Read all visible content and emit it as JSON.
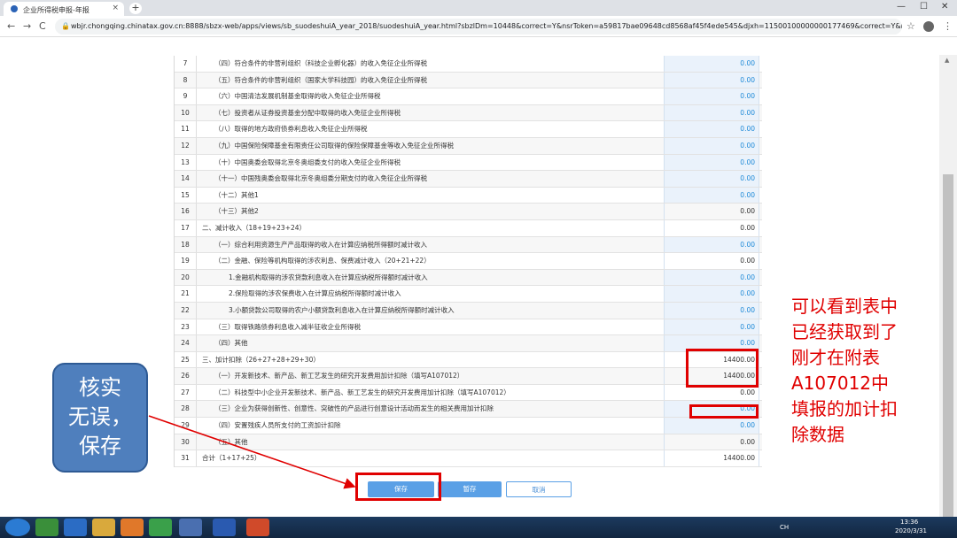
{
  "browser": {
    "tab_title": "企业所得税申报-年报",
    "tab_close": "×",
    "new_tab": "+",
    "url": "wbjr.chongqing.chinatax.gov.cn:8888/sbzx-web/apps/views/sb_suodeshuiA_year_2018/suodeshuiA_year.html?sbzlDm=10448&correct=Y&nsrToken=a59817bae09648cd8568af45f4ede545&djxh=11500100000000177469&correct=Y&r=0.3297732...",
    "back": "←",
    "forward": "→",
    "reload": "C",
    "lock": "🔒",
    "star": "☆",
    "menu": "⋮",
    "minimize": "—",
    "maximize": "☐",
    "close": "✕"
  },
  "table": {
    "rows": [
      {
        "no": "7",
        "item": "（四）符合条件的非营利组织（科技企业孵化器）的收入免征企业所得税",
        "value": "0.00",
        "indent": "in1",
        "style": "blue"
      },
      {
        "no": "8",
        "item": "（五）符合条件的非营利组织（国家大学科技园）的收入免征企业所得税",
        "value": "0.00",
        "indent": "in1",
        "style": "blue"
      },
      {
        "no": "9",
        "item": "（六）中国清洁发展机制基金取得的收入免征企业所得税",
        "value": "0.00",
        "indent": "in1",
        "style": "blue"
      },
      {
        "no": "10",
        "item": "（七）投资者从证券投资基金分配中取得的收入免征企业所得税",
        "value": "0.00",
        "indent": "in1",
        "style": "blue"
      },
      {
        "no": "11",
        "item": "（八）取得的地方政府债券利息收入免征企业所得税",
        "value": "0.00",
        "indent": "in1",
        "style": "blue"
      },
      {
        "no": "12",
        "item": "（九）中国保险保障基金有限责任公司取得的保险保障基金等收入免征企业所得税",
        "value": "0.00",
        "indent": "in1",
        "style": "blue"
      },
      {
        "no": "13",
        "item": "（十）中国奥委会取得北京冬奥组委支付的收入免征企业所得税",
        "value": "0.00",
        "indent": "in1",
        "style": "blue"
      },
      {
        "no": "14",
        "item": "（十一）中国残奥委会取得北京冬奥组委分期支付的收入免征企业所得税",
        "value": "0.00",
        "indent": "in1",
        "style": "blue"
      },
      {
        "no": "15",
        "item": "（十二）其他1",
        "value": "0.00",
        "indent": "in1",
        "style": "blue"
      },
      {
        "no": "16",
        "item": "（十三）其他2",
        "value": "0.00",
        "indent": "in1",
        "style": "dark"
      },
      {
        "no": "17",
        "item": "二、减计收入（18+19+23+24）",
        "value": "0.00",
        "indent": "in0",
        "style": "dark"
      },
      {
        "no": "18",
        "item": "（一）综合利用资源生产产品取得的收入在计算应纳税所得额时减计收入",
        "value": "0.00",
        "indent": "in1",
        "style": "blue"
      },
      {
        "no": "19",
        "item": "（二）金融、保险等机构取得的涉农利息、保费减计收入（20+21+22）",
        "value": "0.00",
        "indent": "in1",
        "style": "dark"
      },
      {
        "no": "20",
        "item": "1.金融机构取得的涉农贷款利息收入在计算应纳税所得额时减计收入",
        "value": "0.00",
        "indent": "in2",
        "style": "blue"
      },
      {
        "no": "21",
        "item": "2.保险取得的涉农保费收入在计算应纳税所得额时减计收入",
        "value": "0.00",
        "indent": "in2",
        "style": "blue"
      },
      {
        "no": "22",
        "item": "3.小额贷款公司取得的农户小额贷款利息收入在计算应纳税所得额时减计收入",
        "value": "0.00",
        "indent": "in2",
        "style": "blue"
      },
      {
        "no": "23",
        "item": "（三）取得铁路债券利息收入减半征收企业所得税",
        "value": "0.00",
        "indent": "in1",
        "style": "blue"
      },
      {
        "no": "24",
        "item": "（四）其他",
        "value": "0.00",
        "indent": "in1",
        "style": "blue"
      },
      {
        "no": "25",
        "item": "三、加计扣除（26+27+28+29+30）",
        "value": "14400.00",
        "indent": "in0",
        "style": "dark"
      },
      {
        "no": "26",
        "item": "（一）开发新技术、新产品、新工艺发生的研究开发费用加计扣除（填写A107012）",
        "value": "14400.00",
        "indent": "in1",
        "style": "dark"
      },
      {
        "no": "27",
        "item": "（二）科技型中小企业开发新技术、新产品、新工艺发生的研究开发费用加计扣除（填写A107012）",
        "value": "0.00",
        "indent": "in1",
        "style": "dark"
      },
      {
        "no": "28",
        "item": "（三）企业为获得创新性、创意性、突破性的产品进行创意设计活动而发生的相关费用加计扣除",
        "value": "0.00",
        "indent": "in1",
        "style": "blue"
      },
      {
        "no": "29",
        "item": "（四）安置残疾人员所支付的工资加计扣除",
        "value": "0.00",
        "indent": "in1",
        "style": "blue"
      },
      {
        "no": "30",
        "item": "（五）其他",
        "value": "0.00",
        "indent": "in1",
        "style": "dark"
      },
      {
        "no": "31",
        "item": "合计（1+17+25）",
        "value": "14400.00",
        "indent": "in0",
        "style": "dark"
      }
    ]
  },
  "actions": {
    "save": "保存",
    "temp_save": "暂存",
    "cancel": "取消"
  },
  "annotations": {
    "callout_lines": [
      "核实",
      "无误，",
      "保存"
    ],
    "red_note": "可以看到表中已经获取到了刚才在附表A107012中填报的加计扣除数据",
    "colors": {
      "highlight": "#e00000",
      "callout_bg": "#4f7fbd"
    }
  },
  "taskbar": {
    "time": "13:36",
    "date": "2020/3/31",
    "lang": "CH"
  }
}
